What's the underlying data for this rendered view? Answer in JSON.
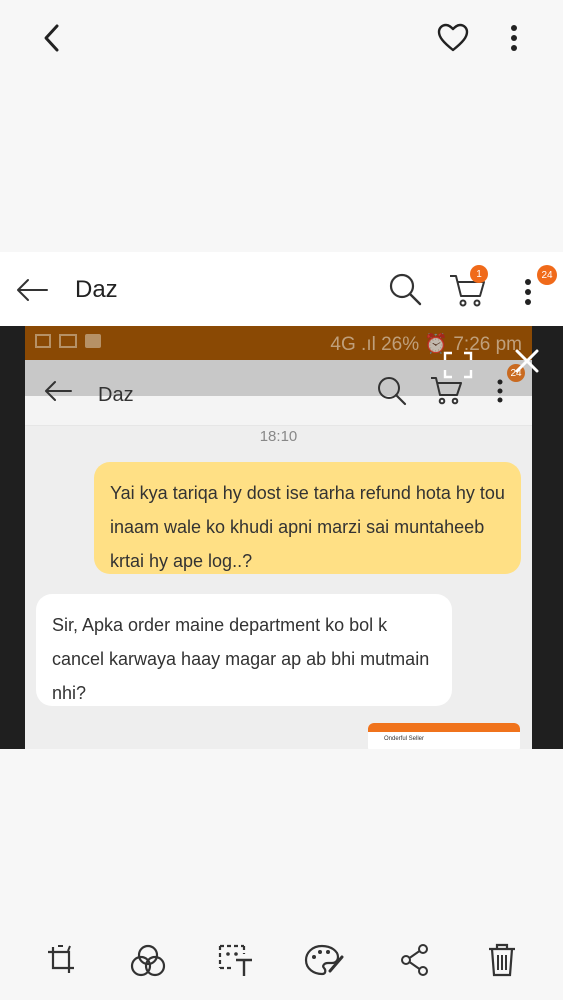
{
  "viewer": {
    "back_icon": "chevron-left-icon",
    "favorite_icon": "heart-icon",
    "more_icon": "more-vertical-icon"
  },
  "chat_screen": {
    "title": "Daz",
    "back_icon": "arrow-left-icon",
    "search_icon": "search-icon",
    "cart_icon": "cart-icon",
    "cart_badge": "1",
    "more_icon": "more-vertical-icon",
    "more_badge": "24"
  },
  "inner_screenshot": {
    "status_text": "4G .ıl 26% ⏰ 7:26 pm",
    "title": "Daz",
    "badge": "24",
    "timestamp": "18:10",
    "messages": [
      {
        "direction": "outgoing",
        "text": "Yai kya tariqa hy dost ise tarha refund hota hy tou inaam wale ko khudi apni marzi sai muntaheeb krtai hy ape log..?"
      },
      {
        "direction": "incoming",
        "text": "Sir, Apka order maine department ko bol k cancel karwaya haay magar ap ab bhi mutmain nhi?"
      }
    ],
    "thumbnail_text": "Onderful Seller"
  },
  "colors": {
    "accent": "#f06a1a",
    "outgoing_bubble": "#ffe085",
    "status_bar": "#a95a06"
  },
  "bottom_toolbar": {
    "items": [
      "rotate-crop-icon",
      "filter-icon",
      "text-select-icon",
      "paint-palette-icon",
      "share-icon",
      "delete-icon"
    ]
  }
}
